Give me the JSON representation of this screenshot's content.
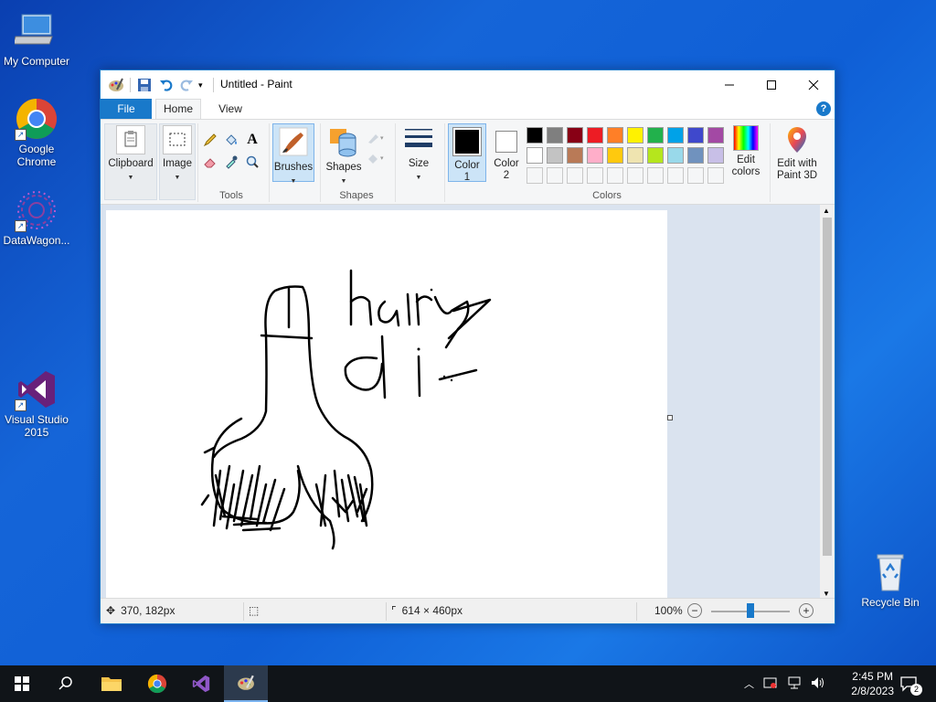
{
  "desktop": {
    "icons": [
      {
        "label": "My Computer"
      },
      {
        "label": "Google Chrome"
      },
      {
        "label": "DataWagon..."
      },
      {
        "label": "Visual Studio 2015"
      },
      {
        "label": "Recycle Bin"
      }
    ]
  },
  "window": {
    "title": "Untitled - Paint",
    "tabs": {
      "file": "File",
      "home": "Home",
      "view": "View"
    },
    "help": "?"
  },
  "ribbon": {
    "clipboard": "Clipboard",
    "image": "Image",
    "tools": "Tools",
    "brushes": "Brushes",
    "shapes_btn": "Shapes",
    "shapes_group": "Shapes",
    "size": "Size",
    "color1": "Color\n1",
    "color1_a": "Color",
    "color1_b": "1",
    "color2_a": "Color",
    "color2_b": "2",
    "colors_group": "Colors",
    "edit_colors_a": "Edit",
    "edit_colors_b": "colors",
    "paint3d_a": "Edit with",
    "paint3d_b": "Paint 3D",
    "text_tool": "A",
    "palette_row1": [
      "#000000",
      "#7f7f7f",
      "#880015",
      "#ed1c24",
      "#ff7f27",
      "#fff200",
      "#22b14c",
      "#00a2e8",
      "#3f48cc",
      "#a349a4"
    ],
    "palette_row2": [
      "#ffffff",
      "#c3c3c3",
      "#b97a57",
      "#ffaec9",
      "#ffc90e",
      "#efe4b0",
      "#b5e61d",
      "#99d9ea",
      "#7092be",
      "#c8bfe7"
    ],
    "active_color1": "#000000",
    "active_color2": "#ffffff"
  },
  "status": {
    "cursor_pos": "370, 182px",
    "canvas_size": "614 × 460px",
    "zoom": "100%",
    "zoom_level": 0.5
  },
  "taskbar": {
    "time": "2:45 PM",
    "date": "2/8/2023",
    "notifications": "2"
  },
  "canvas_drawing": {
    "text": "hairy di"
  }
}
